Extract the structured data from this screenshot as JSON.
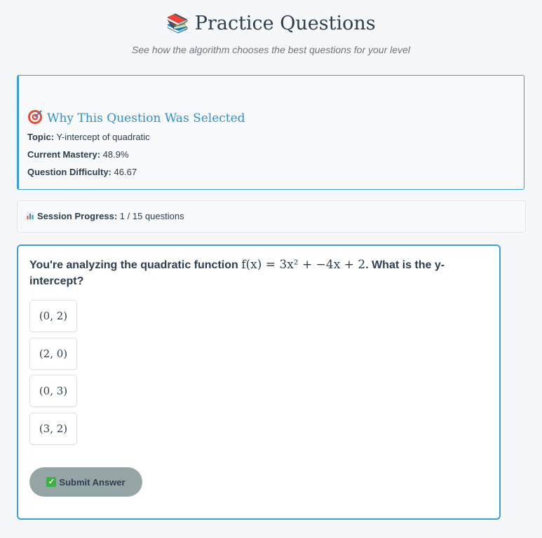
{
  "header": {
    "title_emoji": "📚",
    "title": "Practice Questions",
    "subtitle": "See how the algorithm chooses the best questions for your level"
  },
  "selection_info": {
    "title": "Why This Question Was Selected",
    "icon": "target-icon",
    "topic_label": "Topic:",
    "topic_value": "Y-intercept of quadratic",
    "mastery_label": "Current Mastery:",
    "mastery_value": "48.9%",
    "difficulty_label": "Question Difficulty:",
    "difficulty_value": "46.67"
  },
  "session": {
    "icon": "bar-chart-icon",
    "label": "Session Progress:",
    "value": "1 / 15 questions"
  },
  "question": {
    "prefix": "You're analyzing the quadratic function ",
    "math": "f(x) = 3x² + −4x + 2",
    "suffix": ". What is the y-intercept?",
    "options": [
      "(0, 2)",
      "(2, 0)",
      "(0, 3)",
      "(3, 2)"
    ],
    "submit_label": "Submit Answer"
  },
  "colors": {
    "accent": "#3b9fd6",
    "submit_bg": "#95a5a6",
    "text": "#2c3e50"
  }
}
